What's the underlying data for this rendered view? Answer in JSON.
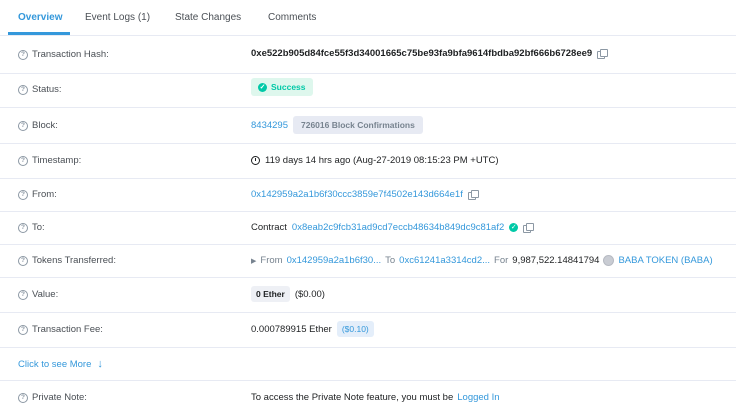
{
  "tabs": [
    {
      "label": "Overview"
    },
    {
      "label": "Event Logs (1)"
    },
    {
      "label": "State Changes"
    },
    {
      "label": "Comments"
    }
  ],
  "rows": {
    "tx_hash": {
      "label": "Transaction Hash:",
      "value": "0xe522b905d84fce55f3d34001665c75be93fa9bfa9614fbdba92bf666b6728ee9"
    },
    "status": {
      "label": "Status:",
      "value": "Success"
    },
    "block": {
      "label": "Block:",
      "number": "8434295",
      "confirmations": "726016 Block Confirmations"
    },
    "timestamp": {
      "label": "Timestamp:",
      "value": "119 days 14 hrs ago (Aug-27-2019 08:15:23 PM +UTC)"
    },
    "from": {
      "label": "From:",
      "value": "0x142959a2a1b6f30ccc3859e7f4502e143d664e1f"
    },
    "to": {
      "label": "To:",
      "prefix": "Contract",
      "value": "0x8eab2c9fcb31ad9cd7eccb48634b849dc9c81af2"
    },
    "tokens": {
      "label": "Tokens Transferred:",
      "from_word": "From",
      "from": "0x142959a2a1b6f30...",
      "to_word": "To",
      "to": "0xc61241a3314cd2...",
      "for_word": "For",
      "amount": "9,987,522.14841794",
      "token": "BABA TOKEN (BABA)"
    },
    "value": {
      "label": "Value:",
      "ether": "0 Ether",
      "usd": "($0.00)"
    },
    "fee": {
      "label": "Transaction Fee:",
      "ether": "0.000789915 Ether",
      "usd": "($0.10)"
    },
    "private_note": {
      "label": "Private Note:",
      "text": "To access the Private Note feature, you must be",
      "link": "Logged In"
    }
  },
  "more_link": "Click to see More",
  "colors": {
    "accent": "#3498db",
    "success": "#00c9a7",
    "border": "#e7eaf3"
  }
}
